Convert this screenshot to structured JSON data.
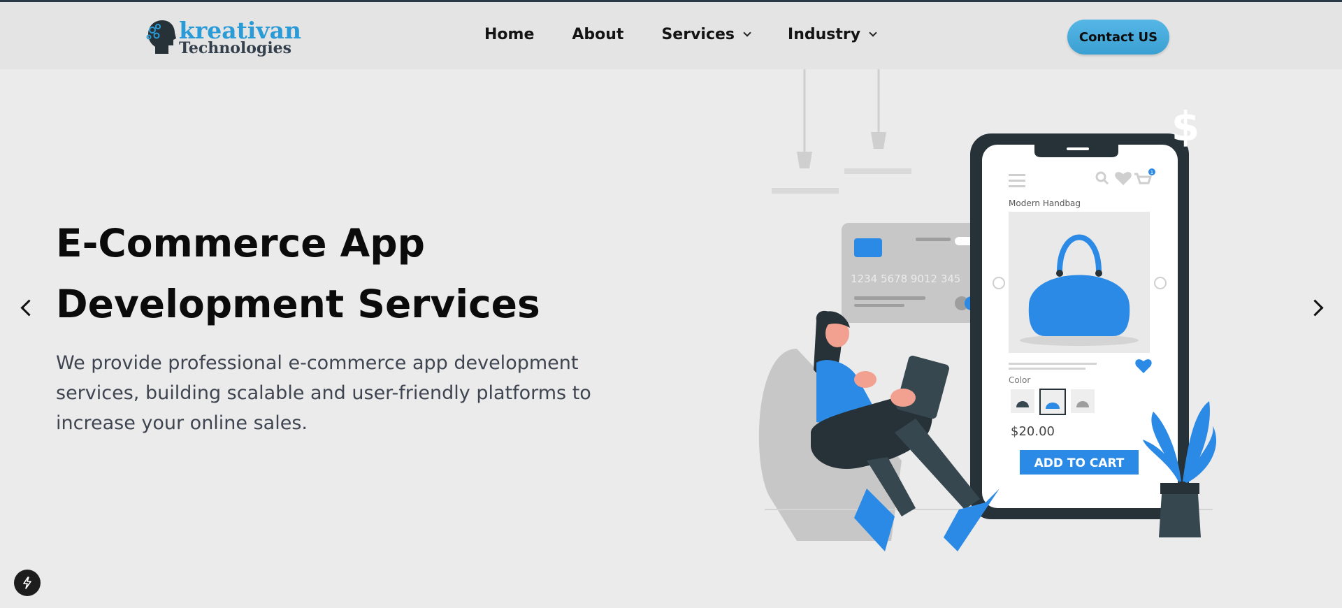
{
  "header": {
    "logo": {
      "line1": "kreativan",
      "line2": "Technologies"
    },
    "nav": {
      "home": "Home",
      "about": "About",
      "services": "Services",
      "industry": "Industry"
    },
    "contact_label": "Contact US"
  },
  "hero": {
    "title_line1": "E-Commerce App",
    "title_line2": "Development Services",
    "desc_line1": "We provide professional e-commerce app development",
    "desc_line2": "services, building scalable and user-friendly platforms to",
    "desc_line3": "increase your online sales."
  },
  "illustration": {
    "card_number": "1234  5678  9012  345",
    "product_title": "Modern Handbag",
    "color_label": "Color",
    "price": "$20.00",
    "add_to_cart": "ADD TO CART",
    "cart_count": "1",
    "dollar": "$"
  },
  "colors": {
    "accent_blue": "#2a9bd6",
    "product_blue": "#2b8ae6",
    "dark": "#37474f",
    "background": "#ebebeb"
  }
}
